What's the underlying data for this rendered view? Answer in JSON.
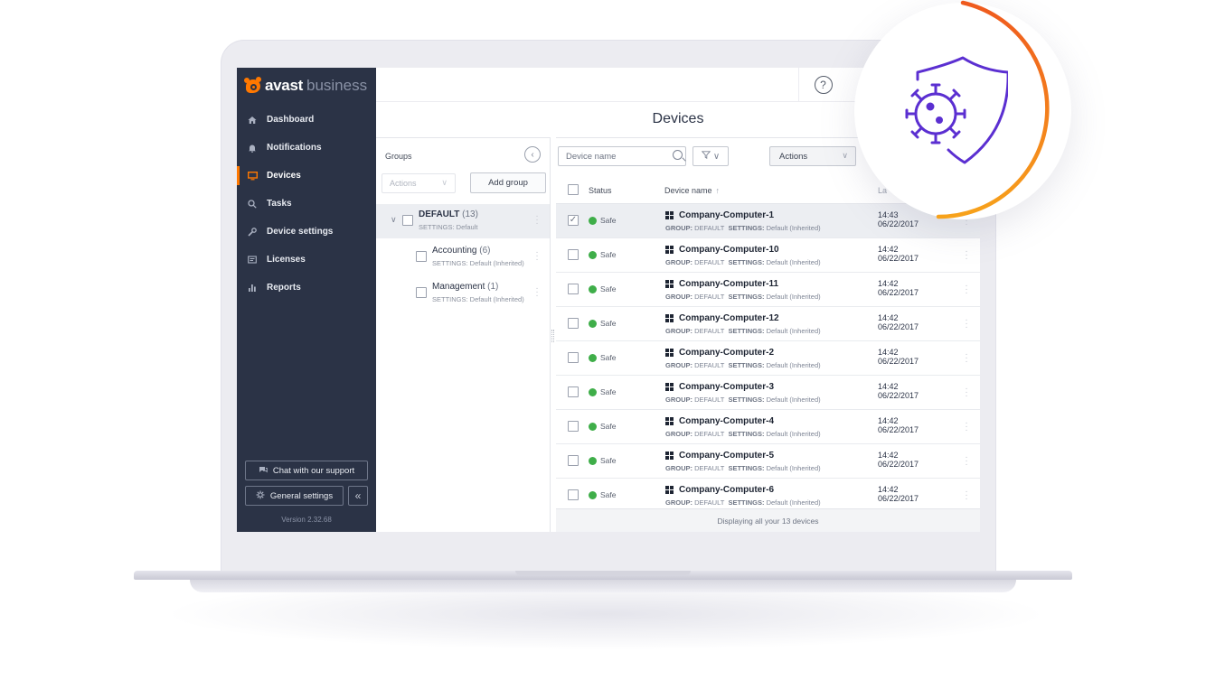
{
  "brand": {
    "name": "avast",
    "sub": "business"
  },
  "sidebar": {
    "items": [
      {
        "label": "Dashboard",
        "icon": "home-icon"
      },
      {
        "label": "Notifications",
        "icon": "bell-icon"
      },
      {
        "label": "Devices",
        "icon": "monitor-icon",
        "active": true
      },
      {
        "label": "Tasks",
        "icon": "search-icon"
      },
      {
        "label": "Device settings",
        "icon": "wrench-icon"
      },
      {
        "label": "Licenses",
        "icon": "license-icon"
      },
      {
        "label": "Reports",
        "icon": "bar-chart-icon"
      }
    ],
    "chat_label": "Chat with our support",
    "general_settings_label": "General settings",
    "version": "Version 2.32.68"
  },
  "topbar": {
    "help_glyph": "?"
  },
  "page": {
    "title": "Devices"
  },
  "groups": {
    "title": "Groups",
    "actions_label": "Actions",
    "add_group_label": "Add group",
    "items": [
      {
        "name": "DEFAULT",
        "count": "(13)",
        "settings": "SETTINGS: Default"
      },
      {
        "name": "Accounting",
        "count": "(6)",
        "settings": "SETTINGS: Default (Inherited)"
      },
      {
        "name": "Management",
        "count": "(1)",
        "settings": "SETTINGS: Default (Inherited)"
      }
    ]
  },
  "devices": {
    "search_placeholder": "Device name",
    "actions_label": "Actions",
    "columns": {
      "status": "Status",
      "name": "Device name",
      "last": "La"
    },
    "rows": [
      {
        "status": "Safe",
        "name": "Company-Computer-1",
        "group": "DEFAULT",
        "settings": "Default (Inherited)",
        "time": "14:43",
        "date": "06/22/2017",
        "checked": true
      },
      {
        "status": "Safe",
        "name": "Company-Computer-10",
        "group": "DEFAULT",
        "settings": "Default (Inherited)",
        "time": "14:42",
        "date": "06/22/2017"
      },
      {
        "status": "Safe",
        "name": "Company-Computer-11",
        "group": "DEFAULT",
        "settings": "Default (Inherited)",
        "time": "14:42",
        "date": "06/22/2017"
      },
      {
        "status": "Safe",
        "name": "Company-Computer-12",
        "group": "DEFAULT",
        "settings": "Default (Inherited)",
        "time": "14:42",
        "date": "06/22/2017"
      },
      {
        "status": "Safe",
        "name": "Company-Computer-2",
        "group": "DEFAULT",
        "settings": "Default (Inherited)",
        "time": "14:42",
        "date": "06/22/2017"
      },
      {
        "status": "Safe",
        "name": "Company-Computer-3",
        "group": "DEFAULT",
        "settings": "Default (Inherited)",
        "time": "14:42",
        "date": "06/22/2017"
      },
      {
        "status": "Safe",
        "name": "Company-Computer-4",
        "group": "DEFAULT",
        "settings": "Default (Inherited)",
        "time": "14:42",
        "date": "06/22/2017"
      },
      {
        "status": "Safe",
        "name": "Company-Computer-5",
        "group": "DEFAULT",
        "settings": "Default (Inherited)",
        "time": "14:42",
        "date": "06/22/2017"
      },
      {
        "status": "Safe",
        "name": "Company-Computer-6",
        "group": "DEFAULT",
        "settings": "Default (Inherited)",
        "time": "14:42",
        "date": "06/22/2017"
      }
    ],
    "group_key": "GROUP:",
    "settings_key": "SETTINGS:",
    "footer": "Displaying all your 13 devices"
  },
  "colors": {
    "sidebar_bg": "#2b3346",
    "accent": "#ff7800",
    "safe": "#3fae49",
    "badge_purple": "#5b2fd1",
    "badge_ring": "#f57c00"
  },
  "badge": {
    "icon": "virus-shield-icon"
  }
}
